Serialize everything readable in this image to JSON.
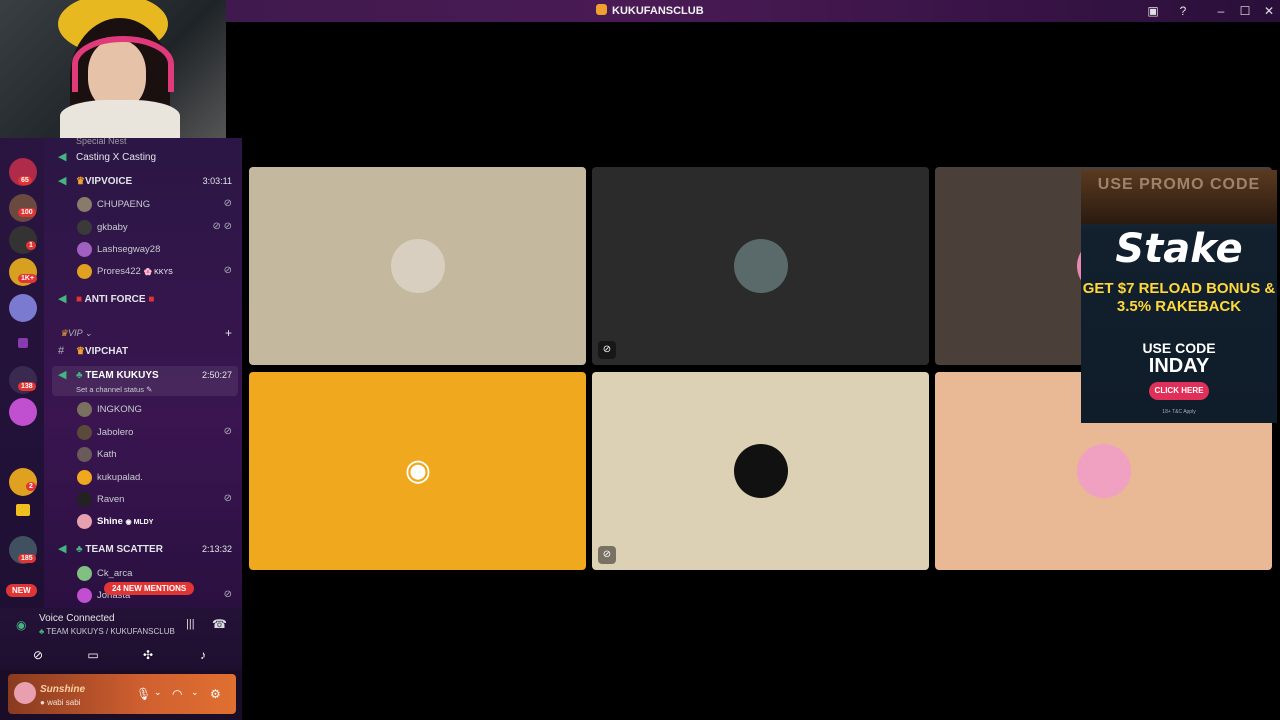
{
  "app": {
    "title": "KUKUFANSCLUB"
  },
  "server_badges": [
    "65",
    "100",
    "1",
    "1K+",
    "138",
    "2",
    "185"
  ],
  "new_label": "NEW",
  "channels": {
    "partial_top": "Special Nest",
    "casting": "Casting X Casting",
    "vipvoice": {
      "name": "VIPVOICE",
      "time": "3:03:11",
      "users": [
        "CHUPAENG",
        "gkbaby",
        "Lashsegway28",
        "Prores422"
      ],
      "prores_tag": "KKYS"
    },
    "antiforce": "ANTI FORCE",
    "category_vip": "VIP",
    "vipchat": "VIPCHAT",
    "team_kukuys": {
      "name": "TEAM KUKUYS",
      "time": "2:50:27",
      "status": "Set a channel status",
      "users": [
        "INGKONG",
        "Jabolero",
        "Kath",
        "kukupalad.",
        "Raven",
        "Shine"
      ],
      "shine_tag": "MLDY"
    },
    "team_scatter": {
      "name": "TEAM SCATTER",
      "time": "2:13:32",
      "users": [
        "Ck_arca",
        "Jonasta"
      ]
    },
    "mentions": "24 NEW MENTIONS"
  },
  "voice": {
    "status": "Voice Connected",
    "channel": "TEAM KUKUYS / KUKUFANSCLUB"
  },
  "current_user": {
    "name": "Sunshine",
    "status": "wabi sabi"
  },
  "tiles": [
    {
      "bg": "#c4b99e",
      "muted": false
    },
    {
      "bg": "#2b2b2b",
      "muted": true
    },
    {
      "bg": "#4a4039",
      "muted": false
    },
    {
      "bg": "#f0a81e",
      "muted": false
    },
    {
      "bg": "#dcd0b5",
      "muted": true
    },
    {
      "bg": "#e8b994",
      "muted": false
    }
  ],
  "ad": {
    "banner": "USE PROMO CODE",
    "logo": "Stake",
    "offer": "GET $7 RELOAD BONUS & 3.5% RAKEBACK",
    "use_code": "USE CODE",
    "code": "INDAY",
    "button": "CLICK HERE",
    "fine_print": "18+  T&C Apply"
  }
}
